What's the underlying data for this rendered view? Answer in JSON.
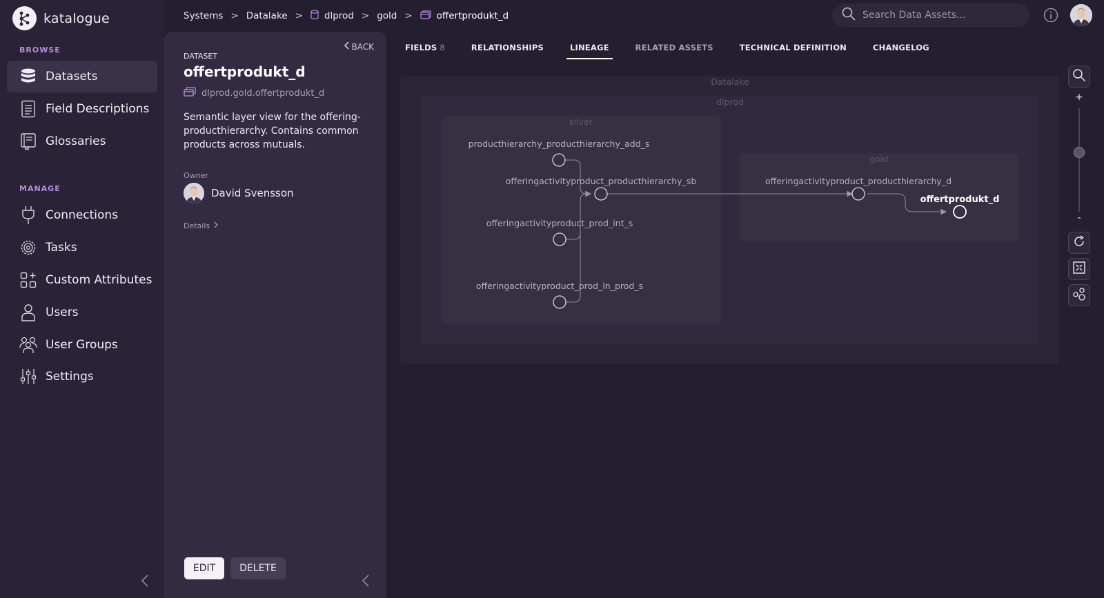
{
  "app": {
    "name": "katalogue"
  },
  "sidebar": {
    "browse_title": "BROWSE",
    "manage_title": "MANAGE",
    "browse_items": [
      {
        "label": "Datasets",
        "icon": "database-icon",
        "active": true
      },
      {
        "label": "Field Descriptions",
        "icon": "document-icon"
      },
      {
        "label": "Glossaries",
        "icon": "book-icon"
      }
    ],
    "manage_items": [
      {
        "label": "Connections",
        "icon": "plug-icon"
      },
      {
        "label": "Tasks",
        "icon": "gear-icon"
      },
      {
        "label": "Custom Attributes",
        "icon": "shapes-icon"
      },
      {
        "label": "Users",
        "icon": "user-icon"
      },
      {
        "label": "User Groups",
        "icon": "users-icon"
      },
      {
        "label": "Settings",
        "icon": "sliders-icon"
      }
    ]
  },
  "breadcrumb": {
    "items": [
      "Systems",
      "Datalake",
      "dlprod",
      "gold",
      "offertprodukt_d"
    ],
    "separator": ">"
  },
  "search": {
    "placeholder": "Search Data Assets..."
  },
  "dataset": {
    "back_label": "BACK",
    "type_label": "DATASET",
    "title": "offertprodukt_d",
    "path": "dlprod.gold.offertprodukt_d",
    "description": "Semantic layer view for the offering-producthierarchy. Contains common products across mutuals.",
    "owner_label": "Owner",
    "owner_name": "David Svensson",
    "details_label": "Details",
    "edit_label": "EDIT",
    "delete_label": "DELETE"
  },
  "tabs": [
    {
      "label": "FIELDS",
      "count": "8",
      "state": "normal"
    },
    {
      "label": "RELATIONSHIPS",
      "state": "normal"
    },
    {
      "label": "LINEAGE",
      "state": "active"
    },
    {
      "label": "RELATED ASSETS",
      "state": "dim"
    },
    {
      "label": "TECHNICAL DEFINITION",
      "state": "normal"
    },
    {
      "label": "CHANGELOG",
      "state": "normal"
    }
  ],
  "lineage": {
    "groups": {
      "system": "Datalake",
      "database": "dlprod",
      "schema_silver": "silver",
      "schema_gold": "gold"
    },
    "nodes": {
      "n1": "producthierarchy_producthierarchy_add_s",
      "n2": "offeringactivityproduct_producthierarchy_sb",
      "n3": "offeringactivityproduct_prod_int_s",
      "n4": "offeringactivityproduct_prod_ln_prod_s",
      "n5": "offeringactivityproduct_producthierarchy_d",
      "n6": "offertprodukt_d"
    }
  },
  "zoom": {
    "plus": "+",
    "minus": "-"
  },
  "colors": {
    "accent": "#b98ce0",
    "background": "#241f2f",
    "sidebar": "#2a2337",
    "panel": "#332b41"
  }
}
